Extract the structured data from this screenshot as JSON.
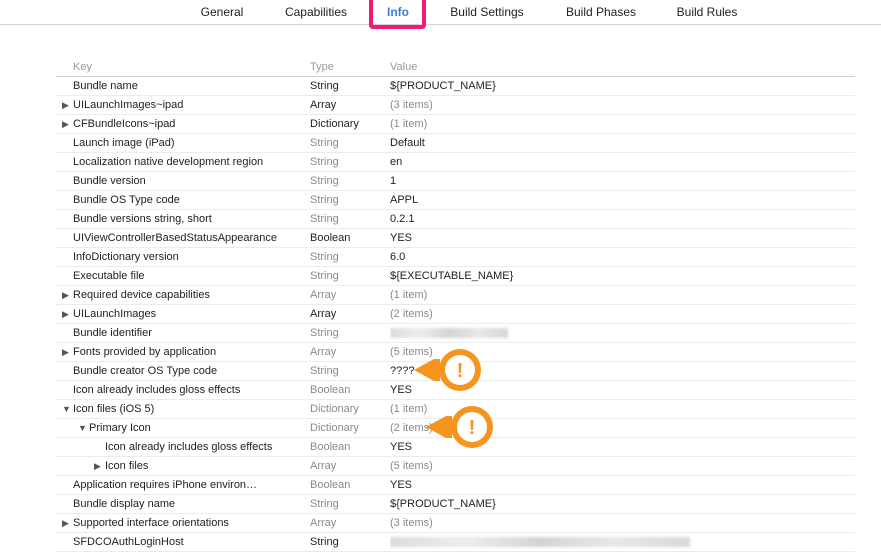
{
  "tabs": [
    {
      "label": "General",
      "active": false
    },
    {
      "label": "Capabilities",
      "active": false
    },
    {
      "label": "Info",
      "active": true
    },
    {
      "label": "Build Settings",
      "active": false
    },
    {
      "label": "Build Phases",
      "active": false
    },
    {
      "label": "Build Rules",
      "active": false
    }
  ],
  "columns": {
    "key": "Key",
    "type": "Type",
    "value": "Value"
  },
  "rows": [
    {
      "key": "Bundle name",
      "type": "String",
      "value": "${PRODUCT_NAME}",
      "disclosure": "",
      "indent": 0,
      "muted": false
    },
    {
      "key": "UILaunchImages~ipad",
      "type": "Array",
      "value": "(3 items)",
      "disclosure": "▶",
      "indent": 0,
      "muted": false
    },
    {
      "key": "CFBundleIcons~ipad",
      "type": "Dictionary",
      "value": "(1 item)",
      "disclosure": "▶",
      "indent": 0,
      "muted": false
    },
    {
      "key": "Launch image (iPad)",
      "type": "String",
      "value": "Default",
      "disclosure": "",
      "indent": 0,
      "muted": true
    },
    {
      "key": "Localization native development region",
      "type": "String",
      "value": "en",
      "disclosure": "",
      "indent": 0,
      "muted": true
    },
    {
      "key": "Bundle version",
      "type": "String",
      "value": "1",
      "disclosure": "",
      "indent": 0,
      "muted": true
    },
    {
      "key": "Bundle OS Type code",
      "type": "String",
      "value": "APPL",
      "disclosure": "",
      "indent": 0,
      "muted": true
    },
    {
      "key": "Bundle versions string, short",
      "type": "String",
      "value": "0.2.1",
      "disclosure": "",
      "indent": 0,
      "muted": true
    },
    {
      "key": "UIViewControllerBasedStatusAppearance",
      "type": "Boolean",
      "value": "YES",
      "disclosure": "",
      "indent": 0,
      "muted": false
    },
    {
      "key": "InfoDictionary version",
      "type": "String",
      "value": "6.0",
      "disclosure": "",
      "indent": 0,
      "muted": true
    },
    {
      "key": "Executable file",
      "type": "String",
      "value": "${EXECUTABLE_NAME}",
      "disclosure": "",
      "indent": 0,
      "muted": true
    },
    {
      "key": "Required device capabilities",
      "type": "Array",
      "value": "(1 item)",
      "disclosure": "▶",
      "indent": 0,
      "muted": true
    },
    {
      "key": "UILaunchImages",
      "type": "Array",
      "value": "(2 items)",
      "disclosure": "▶",
      "indent": 0,
      "muted": false
    },
    {
      "key": "Bundle identifier",
      "type": "String",
      "value": "",
      "disclosure": "",
      "indent": 0,
      "muted": true,
      "redacted": true
    },
    {
      "key": "Fonts provided by application",
      "type": "Array",
      "value": "(5 items)",
      "disclosure": "▶",
      "indent": 0,
      "muted": true
    },
    {
      "key": "Bundle creator OS Type code",
      "type": "String",
      "value": "????",
      "disclosure": "",
      "indent": 0,
      "muted": true
    },
    {
      "key": "Icon already includes gloss effects",
      "type": "Boolean",
      "value": "YES",
      "disclosure": "",
      "indent": 0,
      "muted": true
    },
    {
      "key": "Icon files (iOS 5)",
      "type": "Dictionary",
      "value": "(1 item)",
      "disclosure": "▼",
      "indent": 0,
      "muted": true
    },
    {
      "key": "Primary Icon",
      "type": "Dictionary",
      "value": "(2 items)",
      "disclosure": "▼",
      "indent": 1,
      "muted": true
    },
    {
      "key": "Icon already includes gloss effects",
      "type": "Boolean",
      "value": "YES",
      "disclosure": "",
      "indent": 2,
      "muted": true
    },
    {
      "key": "Icon files",
      "type": "Array",
      "value": "(5 items)",
      "disclosure": "▶",
      "indent": 2,
      "muted": true
    },
    {
      "key": "Application requires iPhone environ…",
      "type": "Boolean",
      "value": "YES",
      "disclosure": "",
      "indent": 0,
      "muted": true
    },
    {
      "key": "Bundle display name",
      "type": "String",
      "value": "${PRODUCT_NAME}",
      "disclosure": "",
      "indent": 0,
      "muted": true
    },
    {
      "key": "Supported interface orientations",
      "type": "Array",
      "value": "(3 items)",
      "disclosure": "▶",
      "indent": 0,
      "muted": true
    },
    {
      "key": "SFDCOAuthLoginHost",
      "type": "String",
      "value": "",
      "disclosure": "",
      "indent": 0,
      "muted": false,
      "redacted": true
    }
  ],
  "colors": {
    "highlight": "#f0197a",
    "callout": "#f7941d",
    "active_tab": "#3a7fd0"
  },
  "callouts": [
    {
      "icon": "warning-callout-icon",
      "glyph": "!"
    },
    {
      "icon": "warning-callout-icon",
      "glyph": "!"
    }
  ]
}
